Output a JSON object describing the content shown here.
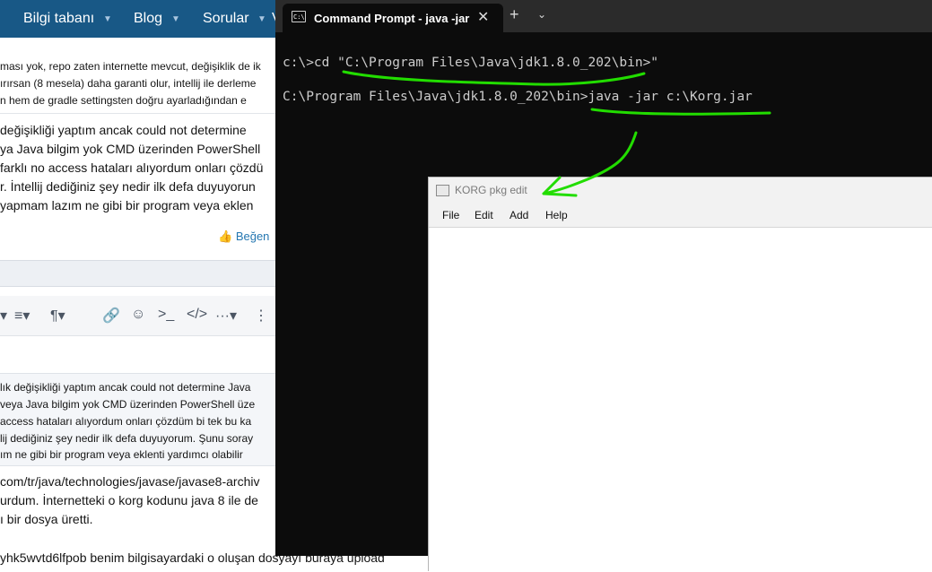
{
  "forum": {
    "nav": [
      {
        "label": "Bilgi tabanı"
      },
      {
        "label": "Blog"
      },
      {
        "label": "Sorular"
      },
      {
        "label": "V"
      }
    ],
    "post1_lines": [
      "ması yok, repo zaten internette mevcut, değişiklik de ik",
      "ırırsan (8 mesela) daha garanti olur, intellij ile derleme",
      "n hem de gradle settingsten doğru ayarladığından e"
    ],
    "post2_lines": [
      "değişikliği yaptım ancak could not determine",
      "ya Java bilgim yok CMD üzerinden PowerShell",
      "farklı no access hataları alıyordum onları çözdü",
      "r. İntellij dediğiniz şey nedir ilk defa duyuyorun",
      "yapmam lazım ne gibi bir program veya eklen"
    ],
    "like_label": "Beğen",
    "toolbar_icons": [
      "align-icon",
      "paragraph-icon",
      "link-icon",
      "emoji-icon",
      "code-inline-icon",
      "code-block-icon",
      "more-icon",
      "drag-handle-icon"
    ],
    "toolbar_glyphs": {
      "align": "≡▾",
      "paragraph": "¶▾",
      "link": "🔗",
      "emoji": "☺",
      "code_inline": ">_",
      "code_block": "</>",
      "more": "···▾",
      "drag": "⋮"
    },
    "quote_lines": [
      "lık değişikliği yaptım ancak could not determine Java",
      "veya Java bilgim yok CMD üzerinden PowerShell üze",
      "access hataları alıyordum onları çözdüm bi tek bu ka",
      "lij dediğiniz şey nedir ilk defa duyuyorum. Şunu soray",
      "ım ne gibi bir program veya eklenti yardımcı olabilir"
    ],
    "reply_lines": [
      "com/tr/java/technologies/javase/javase8-archiv",
      "urdum. İnternetteki o korg kodunu java 8 ile de",
      "ı bir dosya üretti.",
      "yhk5wvtd6lfpob benim bilgisayardaki o oluşan dosyayı buraya upload"
    ]
  },
  "cmd": {
    "tab_title": "Command Prompt - java  -jar",
    "tab_icon_text": "C:\\",
    "close_glyph": "✕",
    "new_tab_glyph": "+",
    "dropdown_glyph": "⌄",
    "lines": [
      "c:\\>cd \"C:\\Program Files\\Java\\jdk1.8.0_202\\bin>\"",
      "C:\\Program Files\\Java\\jdk1.8.0_202\\bin>java -jar c:\\Korg.jar"
    ]
  },
  "korg": {
    "title": "KORG pkg edit",
    "menu": [
      {
        "label": "File"
      },
      {
        "label": "Edit"
      },
      {
        "label": "Add"
      },
      {
        "label": "Help"
      }
    ]
  },
  "annotations": {
    "color": "#22dd00"
  },
  "colors": {
    "forum_nav": "#185886",
    "terminal_bg": "#0c0c0c",
    "terminal_text": "#cccccc",
    "link_blue": "#2577b1"
  }
}
